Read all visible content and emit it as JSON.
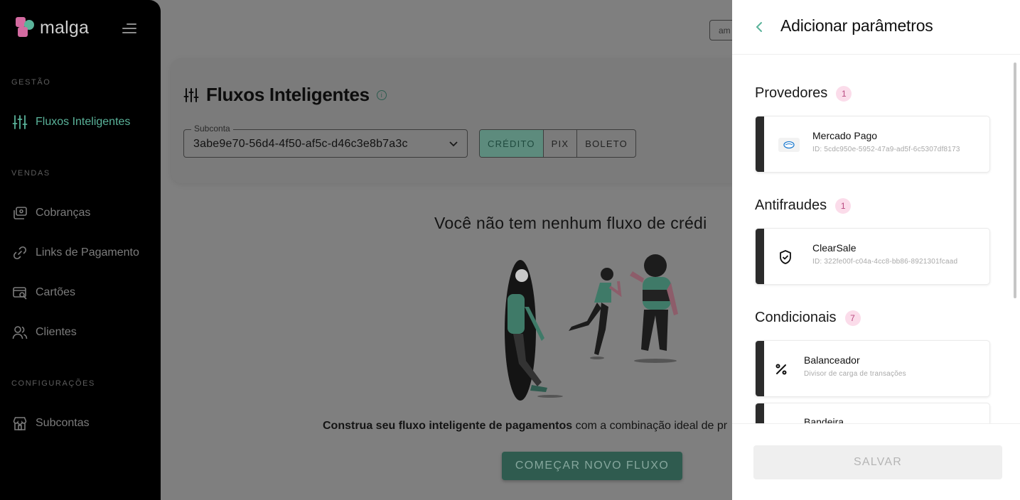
{
  "app": {
    "logo_text": "malga"
  },
  "sidebar": {
    "sections": [
      {
        "label": "GESTÃO"
      },
      {
        "label": "VENDAS"
      },
      {
        "label": "CONFIGURAÇÕES"
      }
    ],
    "items": [
      {
        "label": "Fluxos Inteligentes",
        "icon": "sliders-icon",
        "active": true
      },
      {
        "label": "Cobranças",
        "icon": "billing-icon"
      },
      {
        "label": "Links de Pagamento",
        "icon": "link-icon"
      },
      {
        "label": "Cartões",
        "icon": "card-search-icon"
      },
      {
        "label": "Clientes",
        "icon": "users-icon"
      },
      {
        "label": "Subcontas",
        "icon": "store-icon"
      }
    ]
  },
  "topbar": {
    "account_label": "am"
  },
  "main": {
    "title": "Fluxos Inteligentes",
    "subaccount": {
      "label": "Subconta",
      "value": "3abe9e70-56d4-4f50-af5c-d46c3e8b7a3c"
    },
    "payment_tabs": [
      "CRÉDITO",
      "PIX",
      "BOLETO"
    ],
    "selected_tab": "CRÉDITO",
    "empty_title": "Você não tem nenhum fluxo de crédi",
    "empty_desc_bold": "Construa seu fluxo inteligente de pagamentos",
    "empty_desc_rest": " com a combinação ideal de pr",
    "cta_label": "COMEÇAR NOVO FLUXO"
  },
  "drawer": {
    "title": "Adicionar parâmetros",
    "groups": [
      {
        "title": "Provedores",
        "count": "1",
        "items": [
          {
            "name": "Mercado Pago",
            "sub": "ID: 5cdc950e-5952-47a9-ad5f-6c5307df8173",
            "icon": "mercadopago-logo-icon"
          }
        ]
      },
      {
        "title": "Antifraudes",
        "count": "1",
        "items": [
          {
            "name": "ClearSale",
            "sub": "ID: 322fe00f-c04a-4cc8-bb86-8921301fcaad",
            "icon": "shield-check-icon"
          }
        ]
      },
      {
        "title": "Condicionais",
        "count": "7",
        "items": [
          {
            "name": "Balanceador",
            "sub": "Divisor de carga de transações",
            "icon": "percent-icon"
          },
          {
            "name": "Bandeira",
            "sub": "",
            "icon": "flag-icon"
          }
        ]
      }
    ],
    "save_label": "SALVAR"
  },
  "colors": {
    "accent": "#5ab39a",
    "pink": "#d36aa0",
    "badge_bg": "#fbdcea",
    "badge_text": "#b94a80"
  }
}
